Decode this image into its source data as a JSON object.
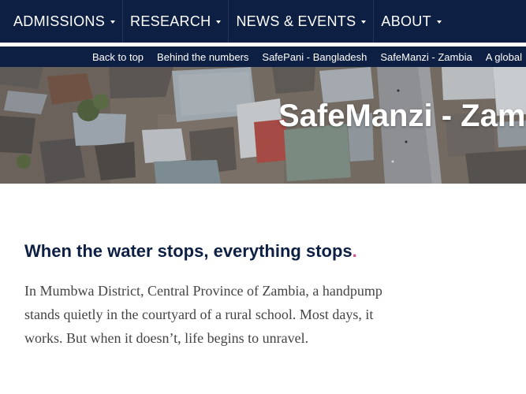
{
  "nav": {
    "items": [
      {
        "label": "ADMISSIONS"
      },
      {
        "label": "RESEARCH"
      },
      {
        "label": "NEWS & EVENTS"
      },
      {
        "label": "ABOUT"
      }
    ]
  },
  "subnav": {
    "links": [
      {
        "label": "Back to top"
      },
      {
        "label": "Behind the numbers"
      },
      {
        "label": "SafePani - Bangladesh"
      },
      {
        "label": "SafeManzi - Zambia"
      },
      {
        "label": "A global"
      }
    ]
  },
  "hero": {
    "title": "SafeManzi - Zamb"
  },
  "article": {
    "headline": "When the water stops, everything stops",
    "headline_punct": ".",
    "intro": "In Mumbwa District, Central Province of Zambia, a handpump stands quietly in the courtyard of a rural school. Most days, it works. But when it doesn’t, life begins to unravel."
  },
  "colors": {
    "nav_bg": "#0e1f44",
    "accent_dot": "#d0528f",
    "headline": "#0e1f44",
    "body_text": "#444444"
  }
}
